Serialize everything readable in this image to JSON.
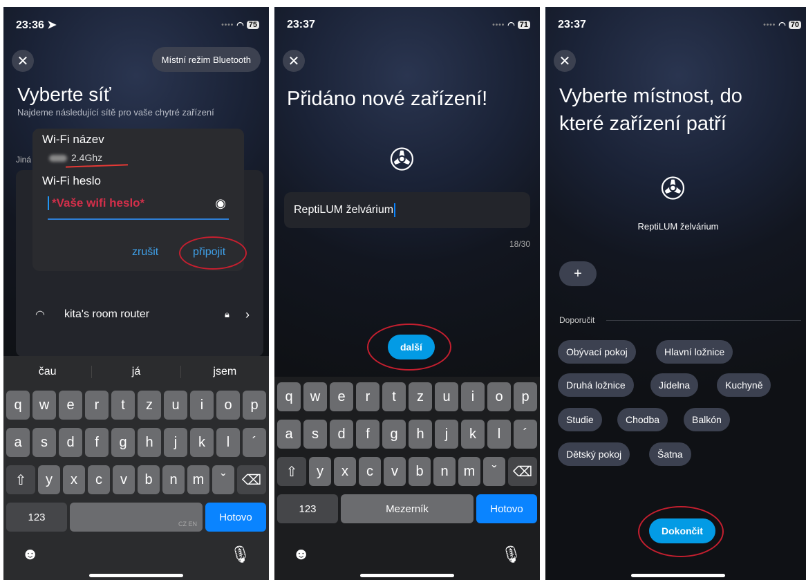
{
  "screen1": {
    "status": {
      "time": "23:36",
      "battery": "75"
    },
    "bluetooth_button": "Místní režim Bluetooth",
    "title": "Vyberte síť",
    "subtitle": "Najdeme následující sítě pro vaše chytré zařízení",
    "other_label": "Jiná",
    "dialog": {
      "wifi_name_label": "Wi-Fi název",
      "ssid_suffix": "2.4Ghz",
      "wifi_password_label": "Wi-Fi heslo",
      "password_value": "*Vaše wifi heslo*",
      "cancel": "zrušit",
      "connect": "připojit"
    },
    "network_name": "kita's room router",
    "suggestions": [
      "čau",
      "já",
      "jsem"
    ],
    "keyboard": {
      "k123": "123",
      "lang": "CZ EN",
      "done": "Hotovo"
    }
  },
  "screen2": {
    "status": {
      "time": "23:37",
      "battery": "71"
    },
    "title": "Přidáno nové zařízení!",
    "device_name_value": "ReptiLUM želvárium",
    "counter": "18/30",
    "next_button": "další",
    "keyboard": {
      "k123": "123",
      "space": "Mezerník",
      "done": "Hotovo"
    }
  },
  "screen3": {
    "status": {
      "time": "23:37",
      "battery": "70"
    },
    "title_line1": "Vyberte místnost, do",
    "title_line2": "které zařízení patří",
    "device_name": "ReptiLUM želvárium",
    "add_label": "+",
    "recommend_label": "Doporučit",
    "rooms": [
      "Obývací pokoj",
      "Hlavní ložnice",
      "Druhá ložnice",
      "Jídelna",
      "Kuchyně",
      "Studie",
      "Chodba",
      "Balkón",
      "Dětský pokoj",
      "Šatna"
    ],
    "finish_button": "Dokončit"
  },
  "keys": {
    "row1": [
      "q",
      "w",
      "e",
      "r",
      "t",
      "z",
      "u",
      "i",
      "o",
      "p"
    ],
    "row2": [
      "a",
      "s",
      "d",
      "f",
      "g",
      "h",
      "j",
      "k",
      "l",
      "´"
    ],
    "row3": [
      "y",
      "x",
      "c",
      "v",
      "b",
      "n",
      "m",
      "ˇ"
    ]
  },
  "icons": {
    "close": "close-icon",
    "eye": "eye-icon",
    "wifi": "wifi-icon",
    "lock": "lock-icon",
    "emoji": "emoji-icon",
    "mic": "mic-icon",
    "device": "film-reel-icon"
  },
  "colors": {
    "accent_blue": "#039be5",
    "annotation_red": "#c51f2f",
    "keyboard_blue": "#0a84ff"
  }
}
